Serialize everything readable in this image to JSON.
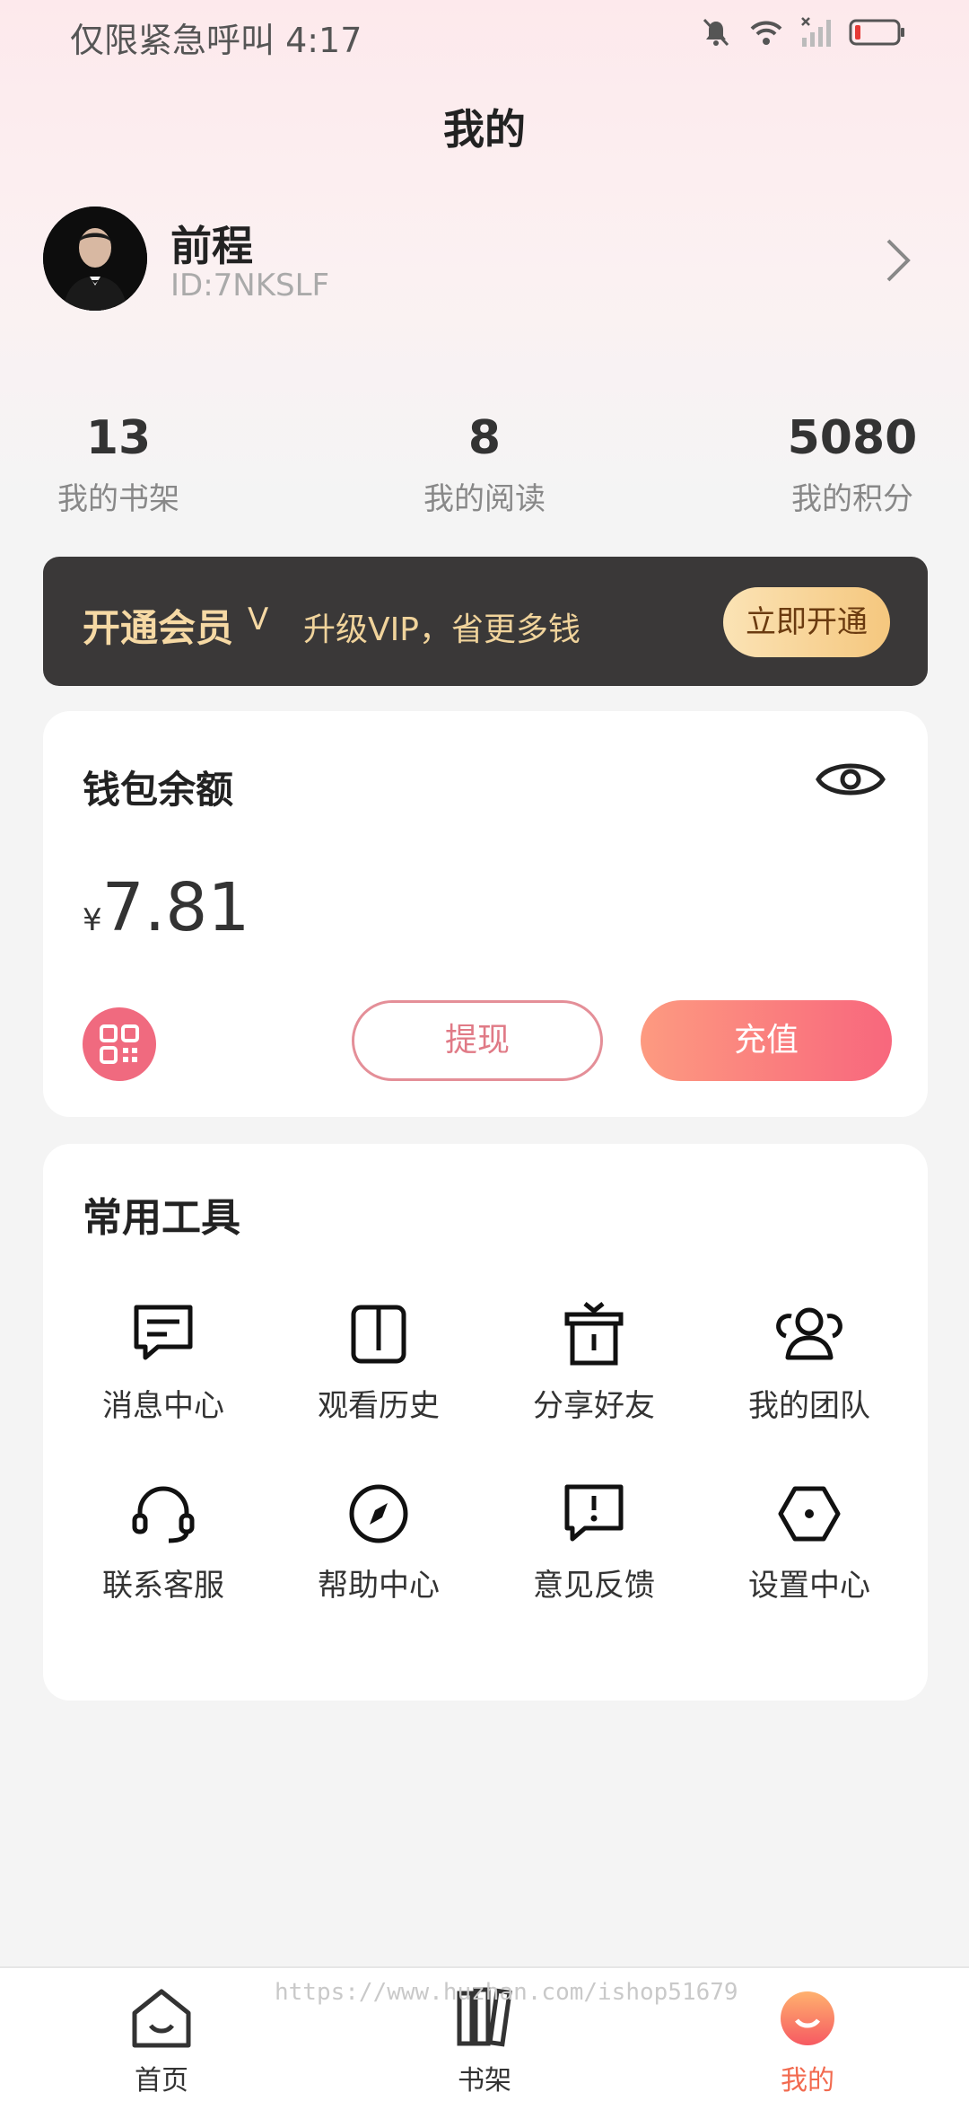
{
  "status_bar": {
    "carrier_time": "仅限紧急呼叫 4:17"
  },
  "header": {
    "title": "我的"
  },
  "profile": {
    "name": "前程",
    "id": "ID:7NKSLF"
  },
  "stats": [
    {
      "value": "13",
      "label": "我的书架"
    },
    {
      "value": "8",
      "label": "我的阅读"
    },
    {
      "value": "5080",
      "label": "我的积分"
    }
  ],
  "vip": {
    "title": "开通会员",
    "mark": "V",
    "subtitle": "升级VIP，省更多钱",
    "button": "立即开通"
  },
  "wallet": {
    "title": "钱包余额",
    "currency": "¥",
    "amount": "7.81",
    "withdraw": "提现",
    "recharge": "充值"
  },
  "tools": {
    "title": "常用工具",
    "items": [
      {
        "label": "消息中心",
        "icon": "message-icon"
      },
      {
        "label": "观看历史",
        "icon": "book-icon"
      },
      {
        "label": "分享好友",
        "icon": "share-icon"
      },
      {
        "label": "我的团队",
        "icon": "team-icon"
      },
      {
        "label": "联系客服",
        "icon": "headset-icon"
      },
      {
        "label": "帮助中心",
        "icon": "compass-icon"
      },
      {
        "label": "意见反馈",
        "icon": "feedback-icon"
      },
      {
        "label": "设置中心",
        "icon": "settings-icon"
      }
    ]
  },
  "nav": [
    {
      "label": "首页",
      "icon": "home-icon"
    },
    {
      "label": "书架",
      "icon": "bookshelf-icon"
    },
    {
      "label": "我的",
      "icon": "profile-icon"
    }
  ],
  "watermark": "https://www.huzhan.com/ishop51679",
  "colors": {
    "accent": "#f8677d",
    "vip_bg": "#3a3838",
    "vip_gold": "#f6d9a4",
    "nav_active": "#f26a4f"
  }
}
